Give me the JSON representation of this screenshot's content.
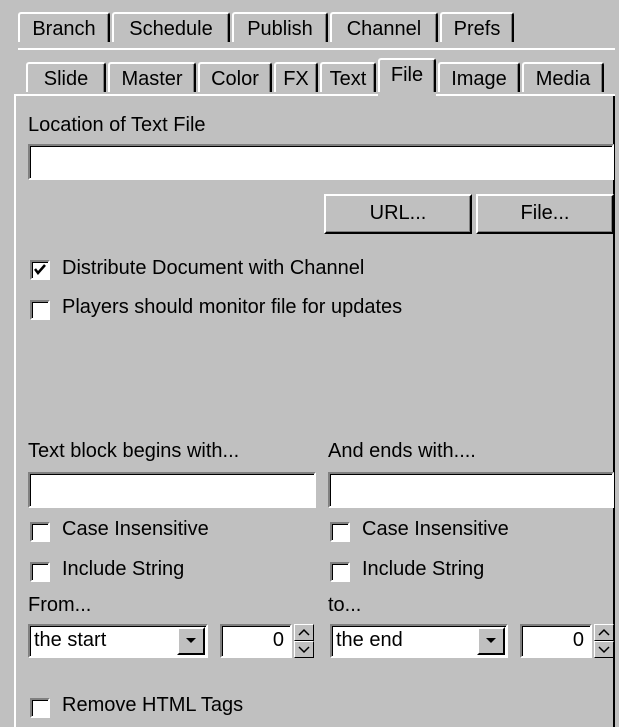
{
  "tabs_row1": [
    {
      "label": "Branch"
    },
    {
      "label": "Schedule"
    },
    {
      "label": "Publish"
    },
    {
      "label": "Channel"
    },
    {
      "label": "Prefs"
    }
  ],
  "tabs_row2": [
    {
      "label": "Slide"
    },
    {
      "label": "Master"
    },
    {
      "label": "Color"
    },
    {
      "label": "FX"
    },
    {
      "label": "Text"
    },
    {
      "label": "File",
      "active": true
    },
    {
      "label": "Image"
    },
    {
      "label": "Media"
    }
  ],
  "file_panel": {
    "location_label": "Location of Text File",
    "location_value": "",
    "url_button": "URL...",
    "file_button": "File...",
    "distribute_label": "Distribute Document with Channel",
    "distribute_checked": true,
    "monitor_label": "Players should monitor file for updates",
    "monitor_checked": false,
    "begins_label": "Text block begins with...",
    "begins_value": "",
    "ends_label": "And ends with....",
    "ends_value": "",
    "case_insensitive_left": "Case Insensitive",
    "case_insensitive_right": "Case Insensitive",
    "include_string_left": "Include String",
    "include_string_right": "Include String",
    "from_label": "From...",
    "to_label": "to...",
    "from_select": "the start",
    "from_offset": "0",
    "to_select": "the end",
    "to_offset": "0",
    "remove_html_label": "Remove HTML Tags"
  }
}
